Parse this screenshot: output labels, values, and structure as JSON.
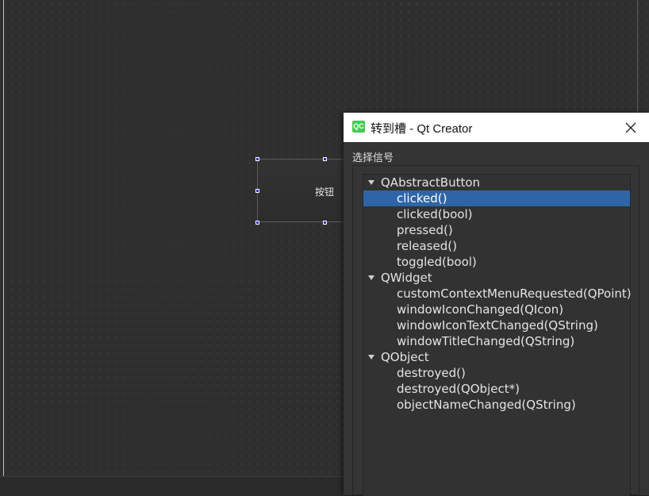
{
  "form": {
    "button_label": "按钮"
  },
  "dialog": {
    "title": "转到槽 - Qt Creator",
    "logo_text": "QC",
    "section_label": "选择信号",
    "groups": [
      {
        "name": "QAbstractButton",
        "signals": [
          "clicked()",
          "clicked(bool)",
          "pressed()",
          "released()",
          "toggled(bool)"
        ]
      },
      {
        "name": "QWidget",
        "signals": [
          "customContextMenuRequested(QPoint)",
          "windowIconChanged(QIcon)",
          "windowIconTextChanged(QString)",
          "windowTitleChanged(QString)"
        ]
      },
      {
        "name": "QObject",
        "signals": [
          "destroyed()",
          "destroyed(QObject*)",
          "objectNameChanged(QString)"
        ]
      }
    ],
    "selected_signal": "clicked()"
  },
  "colors": {
    "selection": "#2f65a7",
    "qt_logo": "#41cd52",
    "handle": "#2b2bd6"
  }
}
